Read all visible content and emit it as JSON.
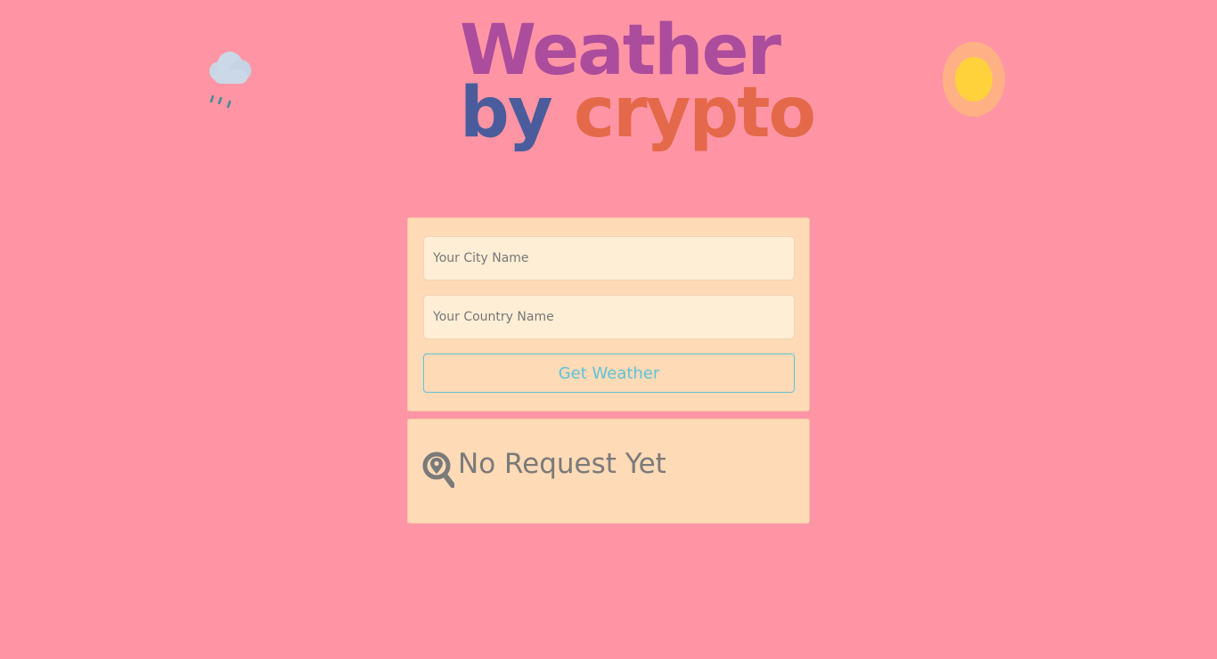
{
  "logo": {
    "line1": "Weather",
    "line2_word1": "by",
    "line2_word2": "crypto"
  },
  "decorations": {
    "cloud_icon": "rain-cloud-icon",
    "sun_icon": "sun-icon"
  },
  "form": {
    "city_placeholder": "Your City Name",
    "country_placeholder": "Your Country Name",
    "submit_label": "Get Weather"
  },
  "result": {
    "icon": "search-location-icon",
    "status": "No Request Yet"
  },
  "colors": {
    "background": "#ff95a4",
    "panel": "#fedab6",
    "input_bg": "#feeed6",
    "button_accent": "#5ec3dc",
    "status_text": "#7a7a7a",
    "logo_purple": "#ab4c9c",
    "logo_red": "#d64b55",
    "logo_blue": "#4a5c9c",
    "logo_orange": "#e4684a"
  }
}
